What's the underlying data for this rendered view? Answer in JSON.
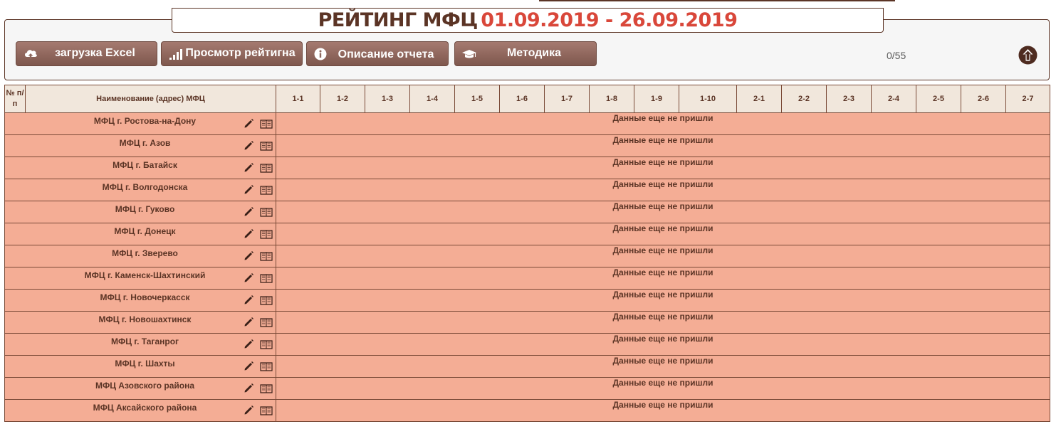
{
  "header": {
    "title": "РЕЙТИНГ МФЦ",
    "period": "01.09.2019 - 26.09.2019"
  },
  "toolbar": {
    "excel_label": "загрузка Excel",
    "rating_label": "Просмотр рейтигна",
    "description_label": "Описание отчета",
    "method_label": "Методика",
    "counter": "0/55"
  },
  "table": {
    "num_header": "№ п/п",
    "name_header": "Наименование (адрес) МФЦ",
    "columns": [
      "1-1",
      "1-2",
      "1-3",
      "1-4",
      "1-5",
      "1-6",
      "1-7",
      "1-8",
      "1-9",
      "1-10",
      "2-1",
      "2-2",
      "2-3",
      "2-4",
      "2-5",
      "2-6",
      "2-7"
    ],
    "no_data": "Данные еще не пришли",
    "rows": [
      "МФЦ г. Ростова-на-Дону",
      "МФЦ г. Азов",
      "МФЦ г. Батайск",
      "МФЦ г. Волгодонска",
      "МФЦ г. Гуково",
      "МФЦ г. Донецк",
      "МФЦ г. Зверево",
      "МФЦ г. Каменск-Шахтинский",
      "МФЦ г. Новочеркасск",
      "МФЦ г. Новошахтинск",
      "МФЦ г. Таганрог",
      "МФЦ г. Шахты",
      "МФЦ Азовского района",
      "МФЦ Аксайского района"
    ]
  },
  "colors": {
    "brand": "#5b3425",
    "accent": "#d9473a",
    "row_bg": "#f4ad95",
    "header_bg": "#f1e7dc"
  },
  "icons": [
    "cloud-upload-icon",
    "bar-chart-icon",
    "info-icon",
    "graduation-cap-icon",
    "arrow-up-circle-icon",
    "pencil-icon",
    "book-icon"
  ]
}
